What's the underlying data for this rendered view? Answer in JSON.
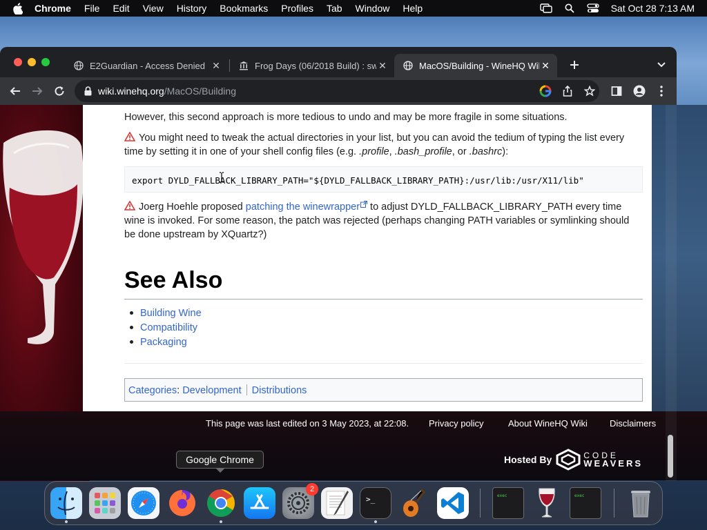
{
  "menubar": {
    "app_name": "Chrome",
    "items": [
      "File",
      "Edit",
      "View",
      "History",
      "Bookmarks",
      "Profiles",
      "Tab",
      "Window",
      "Help"
    ],
    "clock": "Sat Oct 28  7:13 AM"
  },
  "tabs": [
    {
      "title": "E2Guardian - Access Denied",
      "icon": "globe-icon",
      "active": false
    },
    {
      "title": "Frog Days (06/2018 Build) : sw",
      "icon": "archive-icon",
      "active": false
    },
    {
      "title": "MacOS/Building - WineHQ Wiki",
      "icon": "globe-icon",
      "active": true
    }
  ],
  "address": {
    "host": "wiki.winehq.org",
    "path": "/MacOS/Building"
  },
  "article": {
    "p1": "However, this second approach is more tedious to undo and may be more fragile in some situations.",
    "p2_a": "You might need to tweak the actual directories in your list, but you can avoid the tedium of typing the list every time by setting it in one of your shell config files (e.g. ",
    "p2_f1": ".profile",
    "p2_s1": ", ",
    "p2_f2": ".bash_profile",
    "p2_s2": ", or ",
    "p2_f3": ".bashrc",
    "p2_end": "):",
    "code": "export DYLD_FALLBACK_LIBRARY_PATH=\"${DYLD_FALLBACK_LIBRARY_PATH}:/usr/lib:/usr/X11/lib\"",
    "p3_a": "Joerg Hoehle proposed ",
    "p3_link": "patching the winewrapper",
    "p3_b": " to adjust DYLD_FALLBACK_LIBRARY_PATH every time wine is invoked. For some reason, the patch was rejected (perhaps changing PATH variables or symlinking should be done upstream by XQuartz?)",
    "heading": "See Also",
    "see_also": [
      "Building Wine",
      "Compatibility",
      "Packaging"
    ],
    "categories_label": "Categories",
    "categories": [
      "Development",
      "Distributions"
    ]
  },
  "footer": {
    "last_edited": "This page was last edited on 3 May 2023, at 22:08.",
    "privacy": "Privacy policy",
    "about": "About WineHQ Wiki",
    "disclaimers": "Disclaimers",
    "hosted_by": "Hosted By",
    "logo_top": "CODE",
    "logo_bottom": "WEAVERS"
  },
  "tooltip": "Google Chrome",
  "dock": {
    "items": [
      "Finder",
      "Launchpad",
      "Safari",
      "Firefox",
      "Google Chrome",
      "App Store",
      "System Preferences",
      "TextEdit",
      "Terminal",
      "GarageBand",
      "Visual Studio Code",
      "exec",
      "Wine",
      "exec",
      "Trash"
    ],
    "badge": "2"
  },
  "colors": {
    "link": "#3366cc",
    "chrome_dark": "#202124",
    "toolbar": "#35363a"
  }
}
